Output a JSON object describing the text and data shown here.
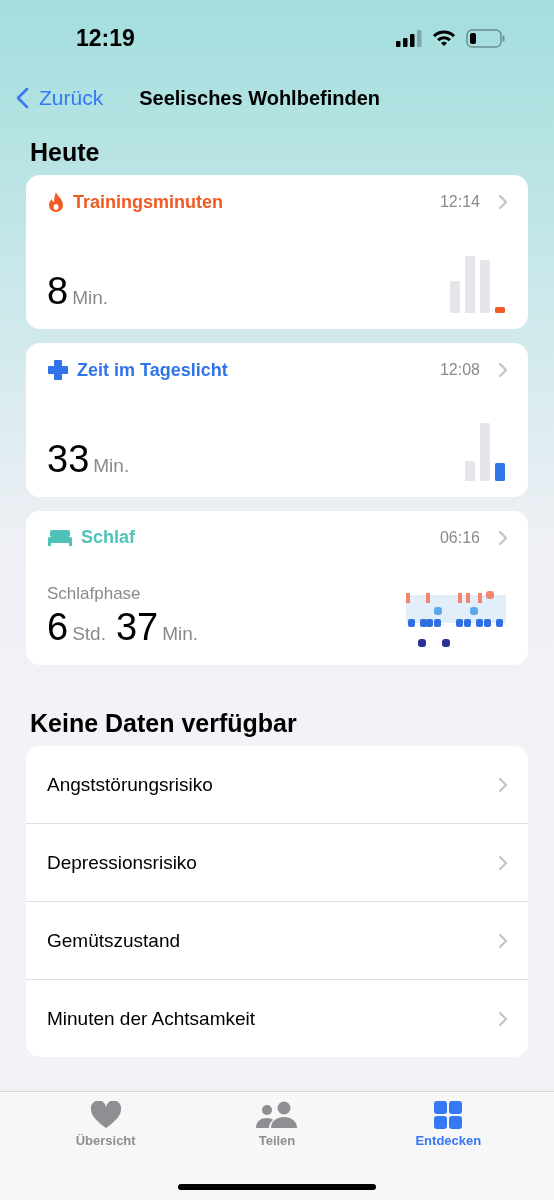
{
  "status_bar": {
    "time": "12:19"
  },
  "nav": {
    "back": "Zurück",
    "title": "Seelisches Wohlbefinden"
  },
  "today": {
    "heading": "Heute",
    "cards": [
      {
        "kind": "training",
        "title": "Trainingsminuten",
        "color": "#f05a23",
        "time": "12:14",
        "values": [
          {
            "number": "8",
            "unit": "Min."
          }
        ]
      },
      {
        "kind": "daylight",
        "title": "Zeit im Tageslicht",
        "color": "#2f74e8",
        "time": "12:08",
        "values": [
          {
            "number": "33",
            "unit": "Min."
          }
        ]
      },
      {
        "kind": "sleep",
        "title": "Schlaf",
        "color": "#4fc3b8",
        "time": "06:16",
        "subtitle": "Schlafphase",
        "values": [
          {
            "number": "6",
            "unit": "Std."
          },
          {
            "number": "37",
            "unit": "Min."
          }
        ]
      }
    ]
  },
  "no_data": {
    "heading": "Keine Daten verfügbar",
    "items": [
      "Angststörungsrisiko",
      "Depressionsrisiko",
      "Gemütszustand",
      "Minuten der Achtsamkeit"
    ]
  },
  "tab_bar": [
    {
      "kind": "summary",
      "label": "Übersicht",
      "selected": false
    },
    {
      "kind": "sharing",
      "label": "Teilen",
      "selected": false
    },
    {
      "kind": "browse",
      "label": "Entdecken",
      "selected": true
    }
  ]
}
